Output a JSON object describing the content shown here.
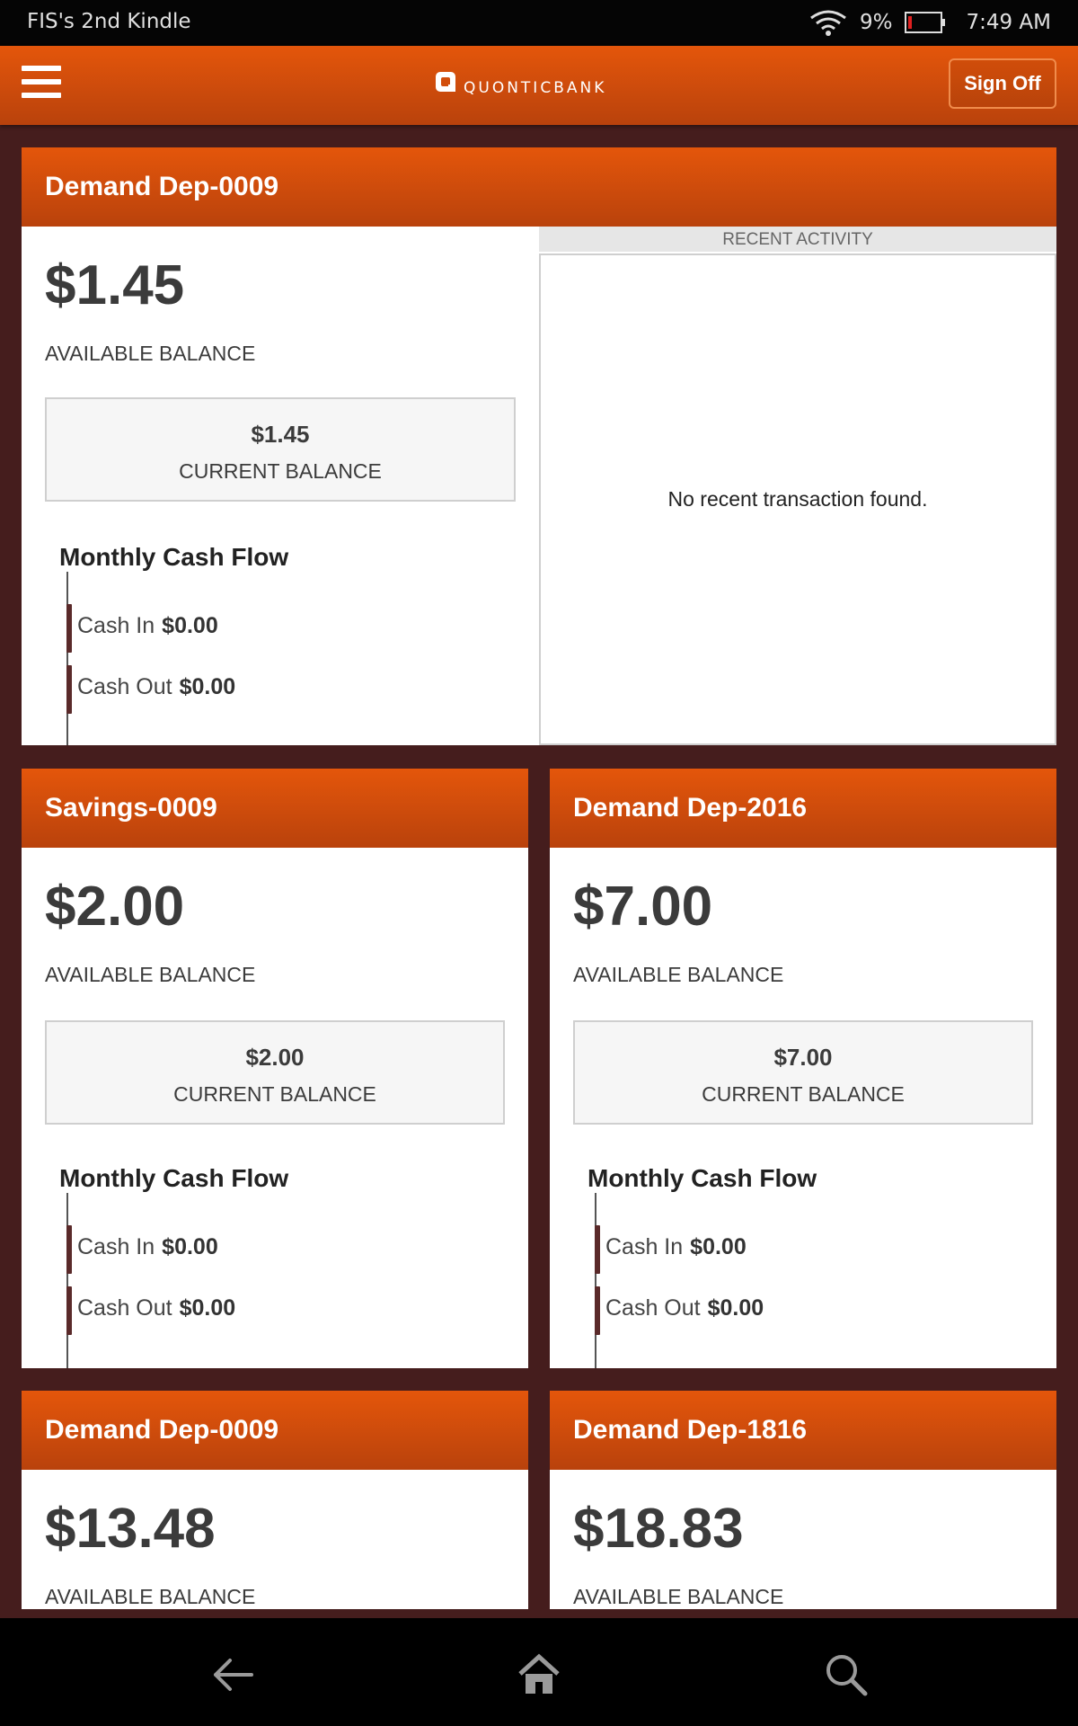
{
  "status_bar": {
    "device_name": "FIS's 2nd Kindle",
    "battery": "9%",
    "time": "7:49 AM"
  },
  "header": {
    "brand": "QUONTICBANK",
    "sign_off": "Sign Off"
  },
  "labels": {
    "available_balance": "AVAILABLE BALANCE",
    "current_balance": "CURRENT BALANCE",
    "monthly_cash_flow": "Monthly Cash Flow",
    "cash_in": "Cash In",
    "cash_out": "Cash Out",
    "recent_activity": "RECENT ACTIVITY",
    "no_recent": "No recent transaction found."
  },
  "accounts": [
    {
      "name": "Demand Dep-0009",
      "available": "$1.45",
      "current": "$1.45",
      "cash_in": "$0.00",
      "cash_out": "$0.00"
    },
    {
      "name": "Savings-0009",
      "available": "$2.00",
      "current": "$2.00",
      "cash_in": "$0.00",
      "cash_out": "$0.00"
    },
    {
      "name": "Demand Dep-2016",
      "available": "$7.00",
      "current": "$7.00",
      "cash_in": "$0.00",
      "cash_out": "$0.00"
    },
    {
      "name": "Demand Dep-0009",
      "available": "$13.48"
    },
    {
      "name": "Demand Dep-1816",
      "available": "$18.83"
    }
  ],
  "colors": {
    "header_orange": "#e4560b",
    "background": "#451d1d"
  },
  "icons": {
    "back": "back-arrow-icon",
    "home": "home-icon",
    "search": "search-icon"
  }
}
